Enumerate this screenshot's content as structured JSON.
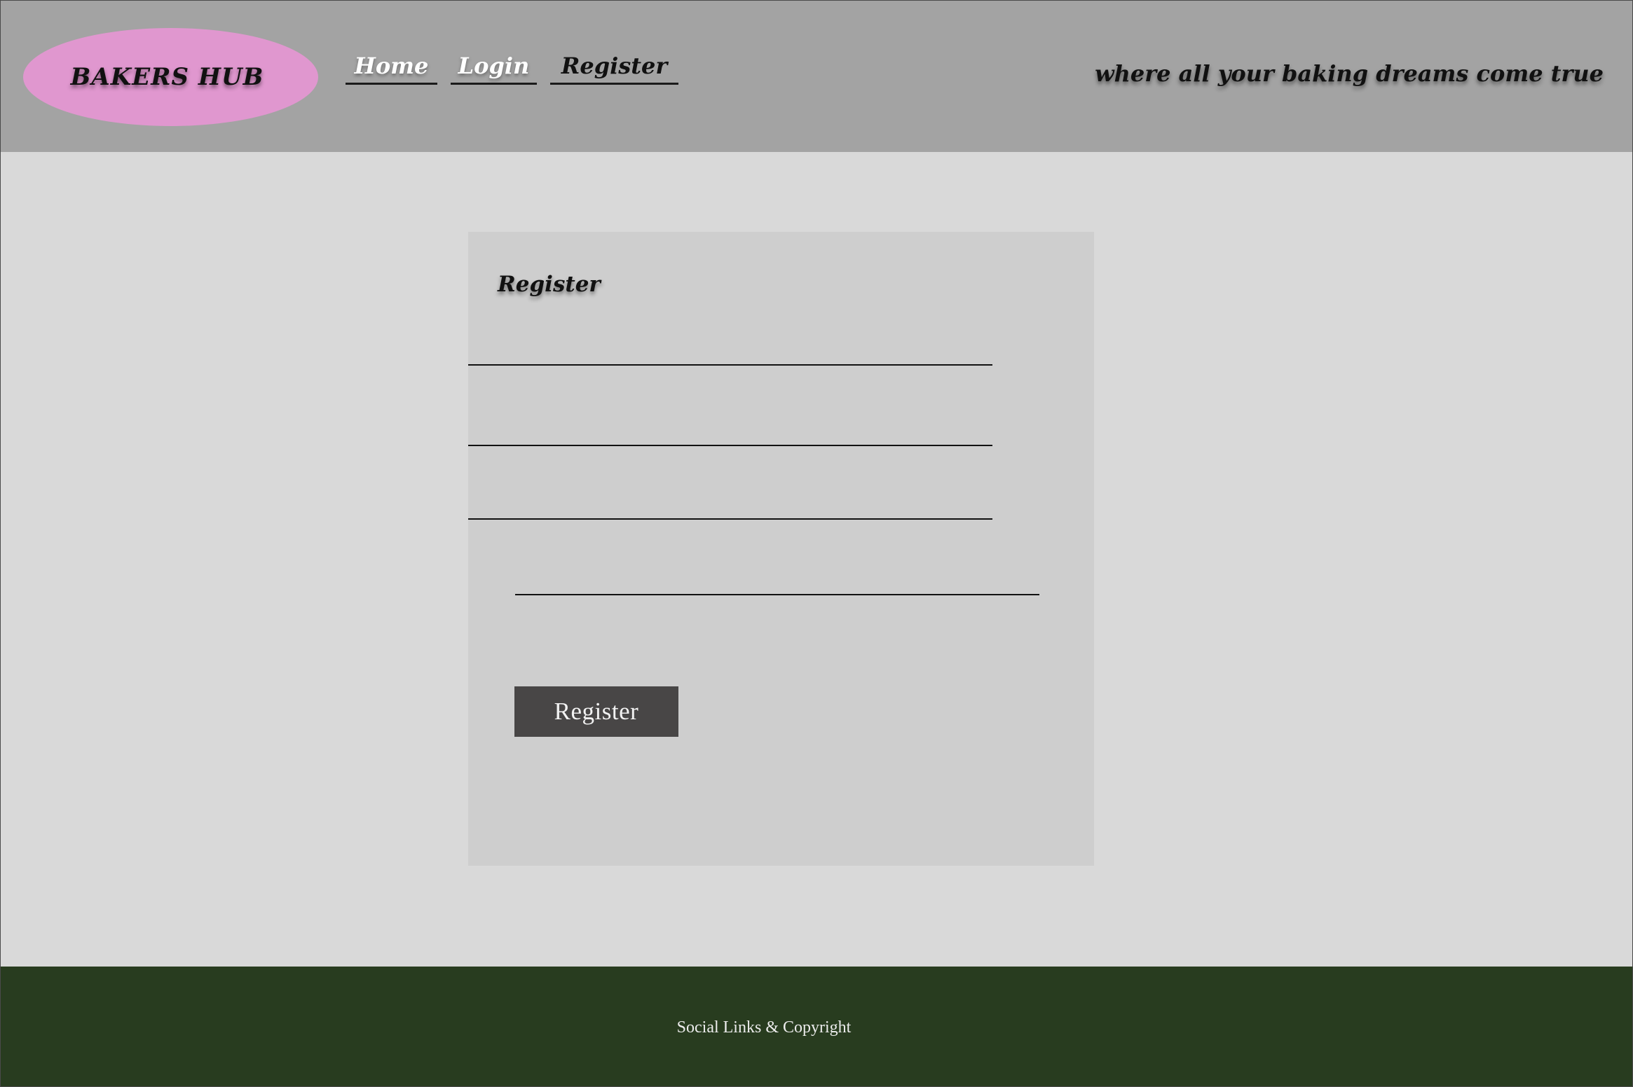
{
  "header": {
    "logo_text": "BAKERS HUB",
    "nav": [
      {
        "label": "Home"
      },
      {
        "label": "Login"
      },
      {
        "label": "Register"
      }
    ],
    "tagline": "where all your baking dreams come true"
  },
  "form": {
    "title": "Register",
    "fields": [
      {
        "value": "",
        "placeholder": ""
      },
      {
        "value": "",
        "placeholder": ""
      },
      {
        "value": "",
        "placeholder": ""
      },
      {
        "value": "",
        "placeholder": ""
      }
    ],
    "submit_label": "Register"
  },
  "footer": {
    "text": "Social Links & Copyright"
  },
  "colors": {
    "header_bg": "#a3a3a3",
    "logo_bg": "#e097cf",
    "page_bg": "#d9d9d9",
    "card_bg": "#cecece",
    "button_bg": "#484646",
    "footer_bg": "#283c1f"
  }
}
